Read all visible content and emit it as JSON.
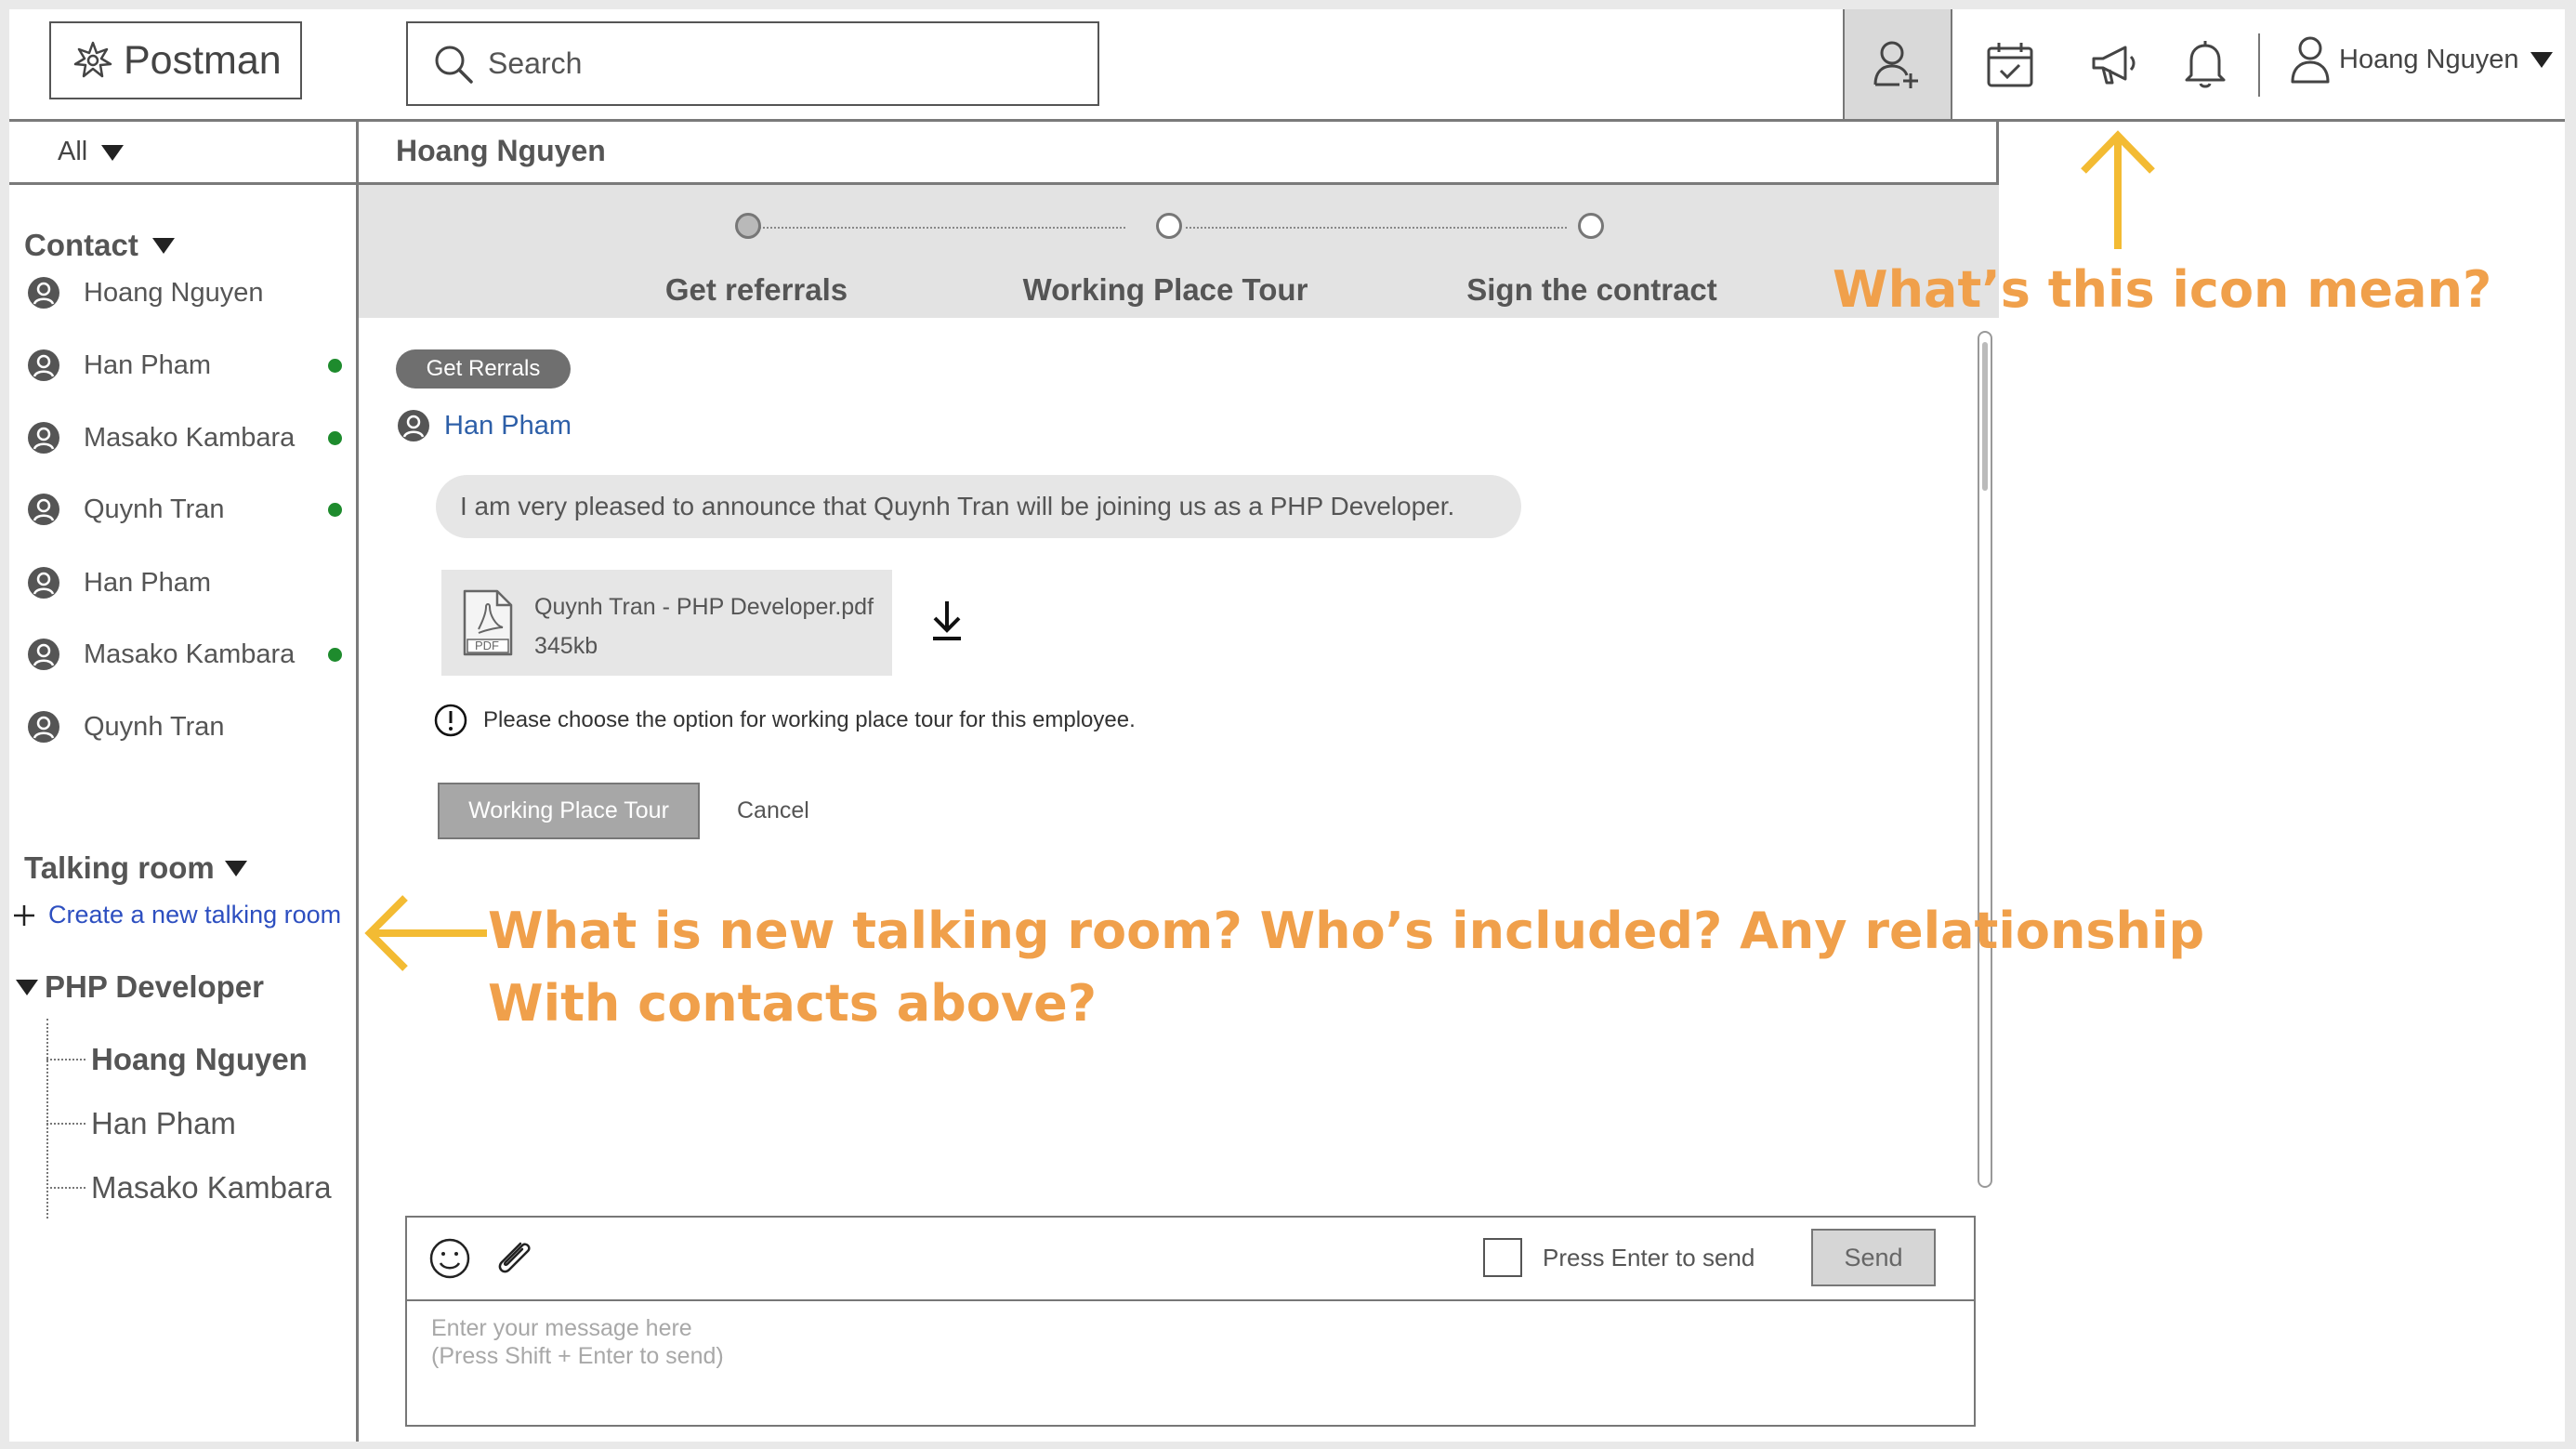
{
  "topbar": {
    "logo": "Postman",
    "search_placeholder": "Search",
    "icons": [
      "add-contact-icon",
      "calendar-icon",
      "megaphone-icon",
      "bell-icon",
      "user-icon"
    ],
    "user_name": "Hoang Nguyen"
  },
  "sidebar": {
    "filter": "All",
    "contacts_title": "Contact",
    "contacts": [
      {
        "name": "Hoang Nguyen",
        "online": false
      },
      {
        "name": "Han Pham",
        "online": true
      },
      {
        "name": "Masako Kambara",
        "online": true
      },
      {
        "name": "Quynh Tran",
        "online": true
      },
      {
        "name": "Han Pham",
        "online": false
      },
      {
        "name": "Masako Kambara",
        "online": true
      },
      {
        "name": "Quynh Tran",
        "online": false
      }
    ],
    "talking_room_title": "Talking room",
    "create_room": "Create a new talking room",
    "group": {
      "title": "PHP Developer",
      "members": [
        "Hoang Nguyen",
        "Han Pham",
        "Masako Kambara"
      ]
    }
  },
  "main": {
    "header": "Hoang Nguyen",
    "steps": [
      "Get referrals",
      "Working Place Tour",
      "Sign the contract"
    ],
    "tag": "Get Rerrals",
    "sender": "Han Pham",
    "message": "I am very pleased to announce that Quynh Tran will be joining us as a PHP Developer.",
    "attachment": {
      "file_name": "Quynh Tran - PHP Developer.pdf",
      "size": "345kb",
      "type_label": "PDF"
    },
    "notice": "Please choose the option for working place tour for this employee.",
    "tour_button": "Working Place Tour",
    "cancel": "Cancel"
  },
  "composer": {
    "enter_to_send": "Press Enter to send",
    "send": "Send",
    "placeholder": "Enter your message here\n(Press Shift + Enter to send)"
  },
  "annotations": {
    "icon_question": "What’s this icon mean?",
    "room_question_1": "What is new talking room? Who’s included? Any relationship",
    "room_question_2": "With contacts above?",
    "color": "#f0a04b",
    "arrow_color": "#f3bb33"
  }
}
